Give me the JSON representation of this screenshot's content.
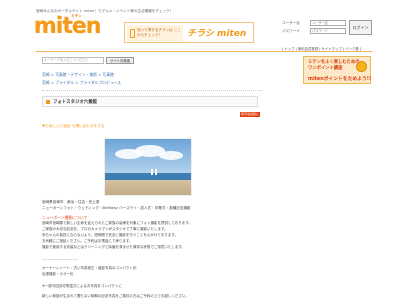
{
  "header": {
    "tagline": "宮崎みんなのポータルサイト miten！でグルメ・イベント等の生活情報をチェック！",
    "logo_text": "miten",
    "logo_sub": "ミテン",
    "banner_left": "知って得するチラシは ここからチェック！",
    "banner_right": "チラシ miten",
    "login": {
      "user_label": "ユーザー名",
      "pass_label": "パスワード",
      "user_placeholder": "ユーザー名",
      "pass_placeholder": "パスワード",
      "button": "ログイン"
    },
    "links": "[ トップ | 無料会員登録 | サイトマップ | リンク集 ]"
  },
  "search": {
    "placeholder": "キーワードを入力してください",
    "button": "サイト内検索"
  },
  "ad": {
    "line1": "ミテンをよく楽しむための",
    "line2": "ワンポイント講座",
    "line3": "mitenポイントをためよう!!"
  },
  "breadcrumbs": [
    "宮崎 > 写真館・デザイン・美術 > 写真館",
    "宮崎 > ブライダル > ブライダルプロデュース"
  ],
  "title": "フォトスタジオ六景館",
  "tag": "携帯電話版に送る",
  "fav": {
    "add": "♥お気に入り追加",
    "contact": "お問い合わせをする"
  },
  "info": [
    "宮崎県宮崎市　都浜・住吉・佐土原",
    "ニューボーンフォト・ウェディング・Birthday バースデイ・成人式・卒業式・各種記念撮影"
  ],
  "section_title": "ニューボーン撮影について",
  "body": [
    "宮崎市宮崎郡で新しい生命を迎えられたご家族の皆様を対象にフォト撮影を提供しております。",
    "ご家族の大切な記念を、プロのカメラマンがスタジオで丁寧に撮影いたします。",
    "赤ちゃんの負担にならないよう、短時間で安全に撮影を行うことを心がけております。",
    "お気軽にご相談ください。ご予約はお電話にて承ります。",
    "撮影で使用する衣装などはクリーニングと除菌を済ませた清潔な状態でご用意いたします。",
    "─────────────────",
    "オーナーレシート・古い写真修正・遺影写真のコンパクト化",
    "出張撮影・カラー化",
    "※一部今回自宅等遠方によるお写真をコンパクトに",
    "新しい家族が生まれて間もない時期の記念写真をご検討の方はご予約の上でお越しください。"
  ]
}
